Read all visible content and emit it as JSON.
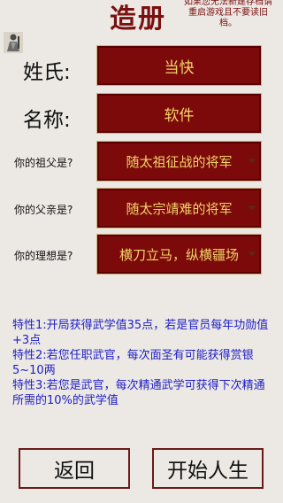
{
  "header": {
    "title": "造册",
    "notice": "如果您无法新建存档请重启游戏且不要读旧档。"
  },
  "form": {
    "surname_label": "姓氏:",
    "surname_value": "当快",
    "name_label": "名称:",
    "name_value": "软件",
    "grandfather_label": "你的祖父是?",
    "grandfather_value": "随太祖征战的将军",
    "father_label": "你的父亲是?",
    "father_value": "随太宗靖难的将军",
    "ideal_label": "你的理想是?",
    "ideal_value": "横刀立马，纵横疆场"
  },
  "traits": {
    "trait1": "特性1:开局获得武学值35点，若是官员每年功勋值+3点",
    "trait2": "特性2:若您任职武官，每次面圣有可能获得赏银5~10两",
    "trait3": "特性3:若您是武官，每次精通武学可获得下次精通所需的10%的武学值"
  },
  "buttons": {
    "back": "返回",
    "start": "开始人生"
  },
  "icons": {
    "avatar": "character-portrait-icon",
    "dropdown": "chevron-down-icon"
  },
  "colors": {
    "field_bg": "#7d0a0a",
    "field_text": "#f2d46a",
    "title": "#7b1010",
    "trait_text": "#1d1dc8"
  }
}
